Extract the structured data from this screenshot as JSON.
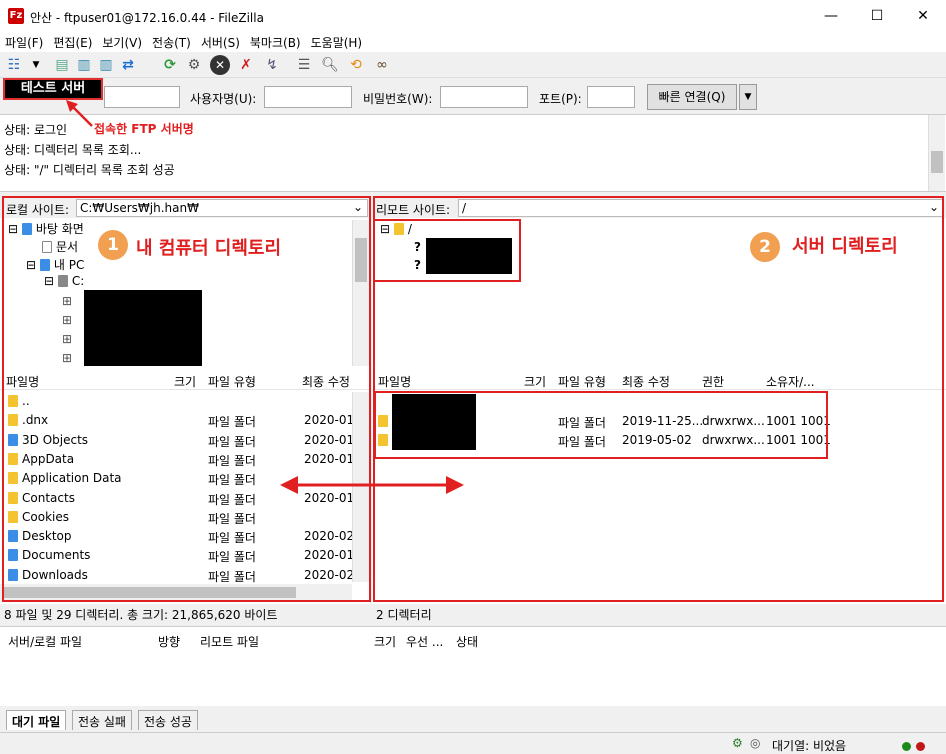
{
  "window": {
    "title": "안산 - ftpuser01@172.16.0.44 - FileZilla",
    "min": "—",
    "max": "☐",
    "close": "✕"
  },
  "menu": [
    "파일(F)",
    "편집(E)",
    "보기(V)",
    "전송(T)",
    "서버(S)",
    "북마크(B)",
    "도움말(H)"
  ],
  "quickconnect": {
    "server_badge": "테스트 서버",
    "user_label": "사용자명(U):",
    "pass_label": "비밀번호(W):",
    "port_label": "포트(P):",
    "connect_label": "빠른 연결(Q)"
  },
  "annotations": {
    "ftp_name": "접속한 FTP 서버명",
    "local": "내 컴퓨터 디렉토리",
    "remote": "서버 디렉토리",
    "n1": "1",
    "n2": "2"
  },
  "log": [
    "상태:  로그인",
    "상태:  디렉터리 목록 조회...",
    "상태:  \"/\" 디렉터리 목록 조회 성공"
  ],
  "local": {
    "site_label": "로컬 사이트:",
    "path": "C:₩Users₩jh.han₩",
    "tree": [
      "바탕 화면",
      "문서",
      "내 PC",
      "C:"
    ],
    "headers": [
      "파일명",
      "크기",
      "파일 유형",
      "최종 수정"
    ],
    "rows": [
      {
        "name": "..",
        "type": "",
        "date": ""
      },
      {
        "name": ".dnx",
        "type": "파일 폴더",
        "date": "2020-01-"
      },
      {
        "name": "3D Objects",
        "type": "파일 폴더",
        "date": "2020-01-"
      },
      {
        "name": "AppData",
        "type": "파일 폴더",
        "date": "2020-01-"
      },
      {
        "name": "Application Data",
        "type": "파일 폴더",
        "date": ""
      },
      {
        "name": "Contacts",
        "type": "파일 폴더",
        "date": "2020-01-"
      },
      {
        "name": "Cookies",
        "type": "파일 폴더",
        "date": ""
      },
      {
        "name": "Desktop",
        "type": "파일 폴더",
        "date": "2020-02-"
      },
      {
        "name": "Documents",
        "type": "파일 폴더",
        "date": "2020-01-"
      },
      {
        "name": "Downloads",
        "type": "파일 폴더",
        "date": "2020-02-"
      }
    ],
    "status": "8 파일 및 29 디렉터리. 총 크기: 21,865,620 바이트"
  },
  "remote": {
    "site_label": "리모트 사이트:",
    "path": "/",
    "tree_root": "/",
    "headers": [
      "파일명",
      "크기",
      "파일 유형",
      "최종 수정",
      "권한",
      "소유자/..."
    ],
    "rows": [
      {
        "type": "파일 폴더",
        "date": "2019-11-25...",
        "perm": "drwxrwx...",
        "owner": "1001 1001"
      },
      {
        "type": "파일 폴더",
        "date": "2019-05-02",
        "perm": "drwxrwx...",
        "owner": "1001 1001"
      }
    ],
    "status": "2 디렉터리"
  },
  "queue": {
    "headers": [
      "서버/로컬 파일",
      "방향",
      "리모트 파일",
      "크기",
      "우선 ...",
      "상태"
    ]
  },
  "tabs": [
    "대기 파일",
    "전송 실패",
    "전송 성공"
  ],
  "statusbar": {
    "queue": "대기열: 비었음"
  }
}
